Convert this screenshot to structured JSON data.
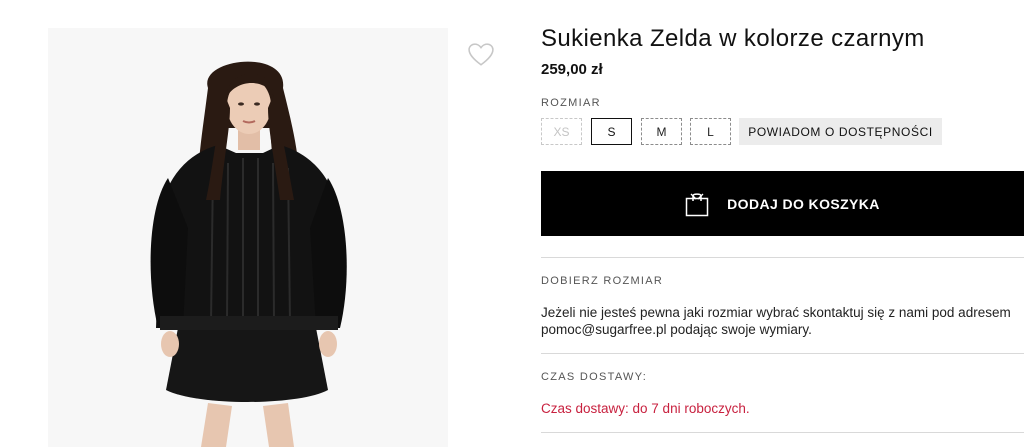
{
  "product": {
    "title": "Sukienka Zelda w kolorze czarnym",
    "price": "259,00 zł",
    "size_label": "ROZMIAR",
    "sizes": [
      {
        "label": "XS",
        "state": "unavailable"
      },
      {
        "label": "S",
        "state": "selected"
      },
      {
        "label": "M",
        "state": "available"
      },
      {
        "label": "L",
        "state": "available"
      }
    ],
    "notify_label": "POWIADOM O DOSTĘPNOŚCI",
    "add_to_cart_label": "DODAJ DO KOSZYKA"
  },
  "size_help": {
    "label": "DOBIERZ ROZMIAR",
    "text": "Jeżeli nie jesteś pewna jaki rozmiar wybrać skontaktuj się z nami pod adresem pomoc@sugarfree.pl podając swoje wymiary."
  },
  "delivery": {
    "label": "CZAS DOSTAWY:",
    "text": "Czas dostawy: do 7 dni roboczych."
  },
  "icons": {
    "wishlist": "heart-icon",
    "cart": "shopping-bag-icon"
  },
  "colors": {
    "primary": "#000000",
    "accent": "#c8213f",
    "notify_bg": "#ececec"
  }
}
